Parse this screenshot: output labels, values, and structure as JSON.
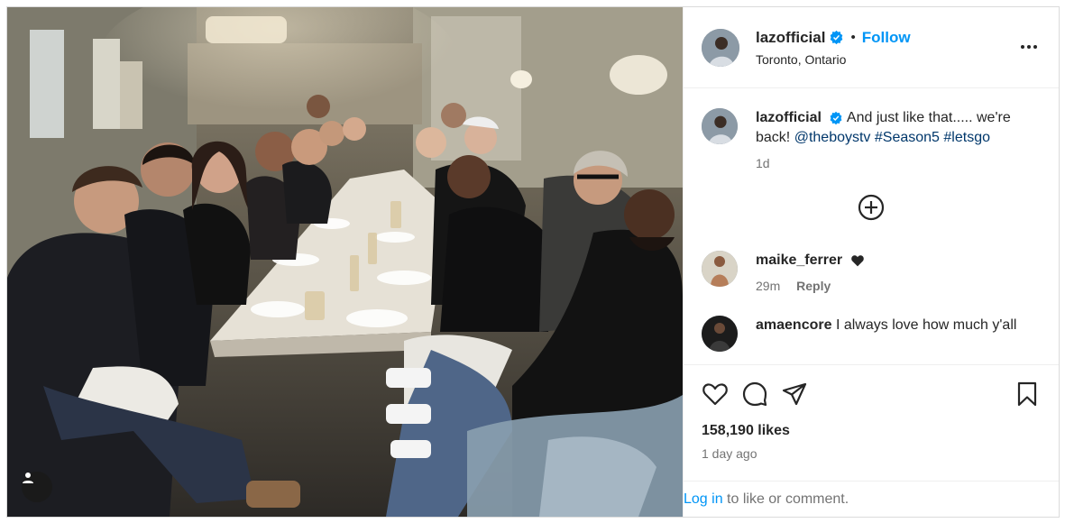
{
  "post": {
    "username": "lazofficial",
    "follow_label": "Follow",
    "separator": "•",
    "location": "Toronto, Ontario"
  },
  "caption": {
    "username": "lazofficial",
    "text": "And just like that..... we're back!",
    "mention": "@theboystv",
    "tags": [
      "#Season5",
      "#letsgo"
    ],
    "age": "1d"
  },
  "comments": [
    {
      "username": "maike_ferrer",
      "text": "",
      "age": "29m",
      "reply_label": "Reply"
    },
    {
      "username": "amaencore",
      "text": "I always love how much y'all",
      "age": "",
      "reply_label": ""
    }
  ],
  "engagement": {
    "likes": "158,190 likes",
    "posted_ago": "1 day ago"
  },
  "login_prompt": {
    "link": "Log in",
    "rest": " to like or comment."
  },
  "colors": {
    "accent": "#0095f6",
    "link": "#00376b",
    "secondary_text": "#737373",
    "border": "#dbdbdb"
  },
  "icons": [
    "more-icon",
    "verified-icon",
    "add-icon",
    "heart-icon",
    "comment-icon",
    "share-icon",
    "bookmark-icon",
    "heart-small-icon",
    "user-tag-icon"
  ]
}
